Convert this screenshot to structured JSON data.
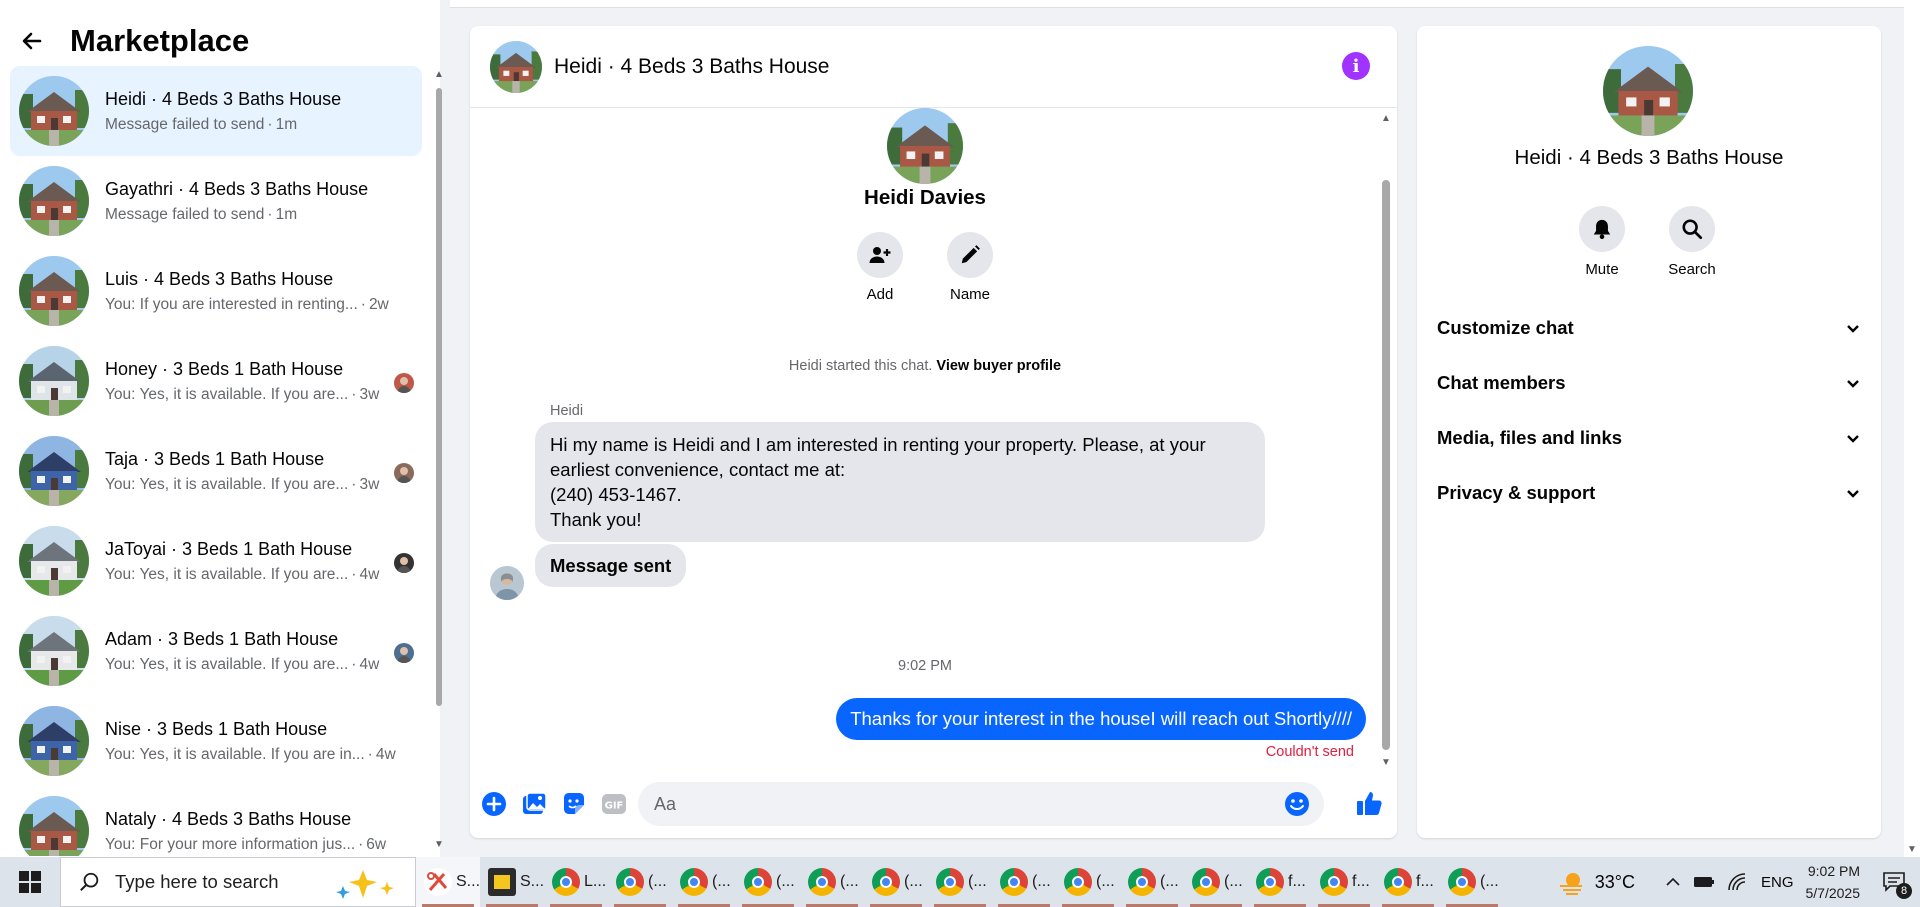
{
  "sidebar": {
    "title": "Marketplace",
    "back_icon": "arrow-left-icon",
    "conversations": [
      {
        "title": "Heidi · 4 Beds 3 Baths House",
        "snippet": "Message failed to send",
        "time": "1m",
        "active": true
      },
      {
        "title": "Gayathri · 4 Beds 3 Baths House",
        "snippet": "Message failed to send",
        "time": "1m"
      },
      {
        "title": "Luis · 4 Beds 3 Baths House",
        "snippet": "You: If you are interested in renting...",
        "time": "2w"
      },
      {
        "title": "Honey · 3 Beds 1 Bath House",
        "snippet": "You: Yes, it is available. If you are...",
        "time": "3w"
      },
      {
        "title": "Taja · 3 Beds 1 Bath House",
        "snippet": "You: Yes, it is available. If you are...",
        "time": "3w"
      },
      {
        "title": "JaToyai · 3 Beds 1 Bath House",
        "snippet": "You: Yes, it is available. If you are...",
        "time": "4w"
      },
      {
        "title": "Adam · 3 Beds 1 Bath House",
        "snippet": "You: Yes, it is available. If you are...",
        "time": "4w"
      },
      {
        "title": "Nise · 3 Beds 1 Bath House",
        "snippet": "You: Yes, it is available. If you are in...",
        "time": "4w"
      },
      {
        "title": "Nataly · 4 Beds 3 Baths House",
        "snippet": "You: For your more information jus...",
        "time": "6w"
      }
    ]
  },
  "chat": {
    "title": "Heidi · 4 Beds 3 Baths House",
    "info_icon": "info-icon",
    "profile": {
      "name": "Heidi Davies",
      "add_label": "Add",
      "name_label": "Name"
    },
    "system": {
      "text": "Heidi started this chat.",
      "link": "View buyer profile"
    },
    "sender": "Heidi",
    "incoming": [
      "Hi my name is Heidi and I am interested in renting your property. Please, at your earliest convenience, contact me at:",
      "(240) 453-1467.",
      "Thank you!"
    ],
    "incoming2": "Message sent",
    "timestamp": "9:02 PM",
    "outgoing": "Thanks for your interest in the houseI will reach out Shortly////",
    "error": "Couldn't send",
    "composer": {
      "placeholder": "Aa"
    }
  },
  "details": {
    "title": "Heidi · 4 Beds 3 Baths House",
    "mute_label": "Mute",
    "search_label": "Search",
    "sections": [
      "Customize chat",
      "Chat members",
      "Media, files and links",
      "Privacy & support"
    ]
  },
  "taskbar": {
    "search_placeholder": "Type here to search",
    "apps": [
      {
        "label": "S...",
        "icon": "snip-icon"
      },
      {
        "label": "S...",
        "icon": "sticky-notes-icon"
      },
      {
        "label": "L...",
        "icon": "chrome-icon"
      },
      {
        "label": "(...",
        "icon": "chrome-icon"
      },
      {
        "label": "(...",
        "icon": "chrome-icon"
      },
      {
        "label": "(...",
        "icon": "chrome-icon"
      },
      {
        "label": "(...",
        "icon": "chrome-icon"
      },
      {
        "label": "(...",
        "icon": "chrome-icon"
      },
      {
        "label": "(...",
        "icon": "chrome-icon"
      },
      {
        "label": "(...",
        "icon": "chrome-icon"
      },
      {
        "label": "(...",
        "icon": "chrome-icon"
      },
      {
        "label": "(...",
        "icon": "chrome-icon"
      },
      {
        "label": "(...",
        "icon": "chrome-icon"
      },
      {
        "label": "f...",
        "icon": "chrome-icon"
      },
      {
        "label": "f...",
        "icon": "chrome-icon"
      },
      {
        "label": "f...",
        "icon": "chrome-icon"
      },
      {
        "label": "(...",
        "icon": "chrome-icon"
      }
    ],
    "temperature": "33°C",
    "language": "ENG",
    "time": "9:02 PM",
    "date": "5/7/2025",
    "notifications": "8"
  },
  "colors": {
    "accent": "#0866ff",
    "info": "#a033ff",
    "error": "#e41e3f",
    "active_row": "#e7f3ff"
  }
}
